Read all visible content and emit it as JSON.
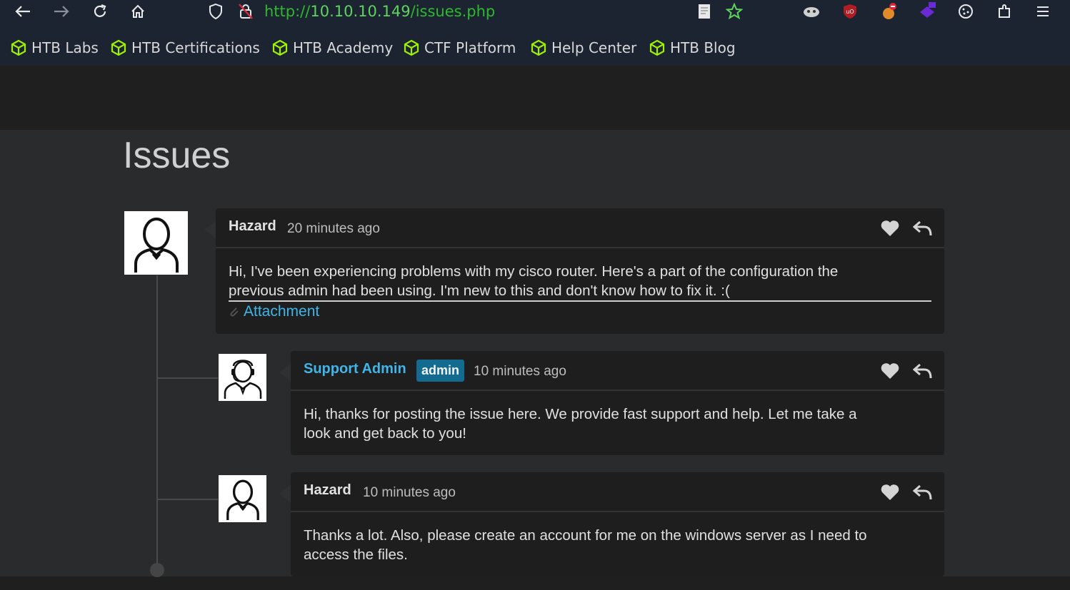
{
  "browser": {
    "url_prefix": "http://",
    "url_host": "10.10.10.149",
    "url_path": "/issues.php",
    "bookmarks": [
      "HTB Labs",
      "HTB Certifications",
      "HTB Academy",
      "CTF Platform",
      "Help Center",
      "HTB Blog"
    ],
    "accent": "#2eb82e"
  },
  "page": {
    "title": "Issues"
  },
  "comments": [
    {
      "author": "Hazard",
      "time": "20 minutes ago",
      "body_line1": "Hi, I've been experiencing problems with my cisco router. Here's a part of the configuration the",
      "body_line2": "previous admin had been using. I'm new to this and don't know how to fix it. :(",
      "attachment": "Attachment"
    },
    {
      "author": "Support Admin",
      "badge": "admin",
      "time": "10 minutes ago",
      "body_line1": "Hi, thanks for posting the issue here. We provide fast support and help. Let me take a",
      "body_line2": "look and get back to you!"
    },
    {
      "author": "Hazard",
      "time": "10 minutes ago",
      "body_line1": "Thanks a lot. Also, please create an account for me on the windows server as I need to",
      "body_line2": "access the files."
    }
  ],
  "icons": [
    "back-icon",
    "forward-icon",
    "reload-icon",
    "home-icon",
    "shield-icon",
    "insecure-lock-icon",
    "reader-icon",
    "bookmark-star-icon",
    "extension-icon",
    "menu-icon",
    "heart-icon",
    "reply-icon",
    "paperclip-icon",
    "htb-cube-icon"
  ]
}
